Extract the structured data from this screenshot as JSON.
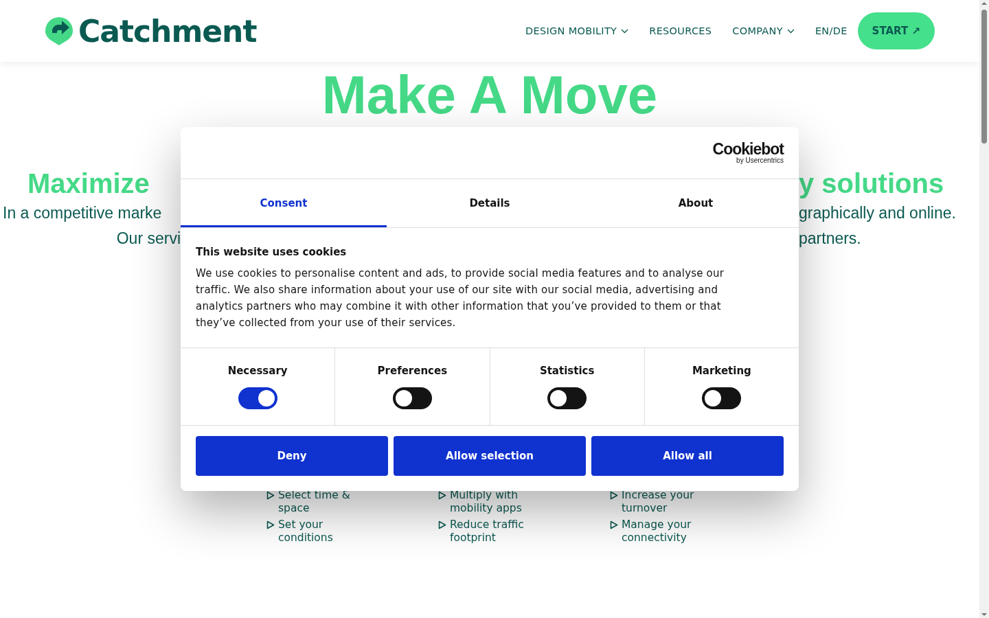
{
  "header": {
    "logo": "Catchment",
    "nav": [
      {
        "label": "DESIGN MOBILITY",
        "dropdown": true
      },
      {
        "label": "RESOURCES",
        "dropdown": false
      },
      {
        "label": "COMPANY",
        "dropdown": true
      },
      {
        "label": "EN/DE",
        "dropdown": false
      }
    ],
    "cta": "START ↗"
  },
  "hero": {
    "title": "Make A Move",
    "subtitle": {
      "left": "Maximize",
      "right": "y solutions"
    },
    "lines": [
      {
        "left": "In a competitive marke",
        "right": "graphically and online."
      },
      {
        "left": "Our servi",
        "right": "partners."
      }
    ]
  },
  "features": [
    {
      "items": [
        "Select time & space",
        "Set your conditions"
      ]
    },
    {
      "items": [
        "Multiply with mobility apps",
        "Reduce traffic footprint"
      ]
    },
    {
      "items": [
        "Increase your turnover",
        "Manage your connectivity"
      ]
    }
  ],
  "cookie_dialog": {
    "brand": "Cookiebot",
    "brand_sub": "by Usercentrics",
    "tabs": [
      {
        "label": "Consent",
        "selected": true
      },
      {
        "label": "Details",
        "selected": false
      },
      {
        "label": "About",
        "selected": false
      }
    ],
    "heading": "This website uses cookies",
    "text": "We use cookies to personalise content and ads, to provide social media features and to analyse our traffic. We also share information about your use of our site with our social media, advertising and analytics partners who may combine it with other information that you’ve provided to them or that they’ve collected from your use of their services.",
    "categories": [
      {
        "label": "Necessary",
        "checked": true
      },
      {
        "label": "Preferences",
        "checked": false
      },
      {
        "label": "Statistics",
        "checked": false
      },
      {
        "label": "Marketing",
        "checked": false
      }
    ],
    "buttons": [
      "Deny",
      "Allow selection",
      "Allow all"
    ]
  }
}
